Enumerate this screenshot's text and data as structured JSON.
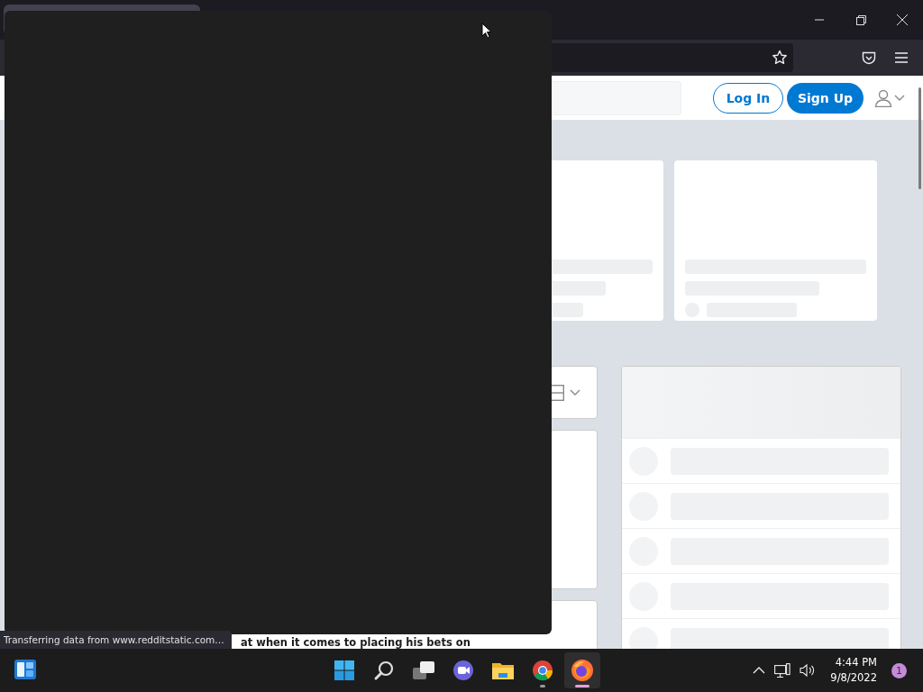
{
  "page": {
    "header": {
      "login": "Log In",
      "signup": "Sign Up"
    },
    "post_title": "at when it comes to placing his bets on"
  },
  "status_text": "Transferring data from www.redditstatic.com…",
  "taskbar": {
    "apps": [
      {
        "kind": "start",
        "running": false,
        "selected": false
      },
      {
        "kind": "search",
        "running": false,
        "selected": false
      },
      {
        "kind": "taskview",
        "running": false,
        "selected": false
      },
      {
        "kind": "chat",
        "running": false,
        "selected": false
      },
      {
        "kind": "explorer",
        "running": false,
        "selected": false
      },
      {
        "kind": "chrome",
        "running": true,
        "selected": false
      },
      {
        "kind": "firefox",
        "running": true,
        "selected": true
      }
    ],
    "clock": {
      "time": "4:44 PM",
      "date": "9/8/2022"
    },
    "notification_count": "1"
  }
}
